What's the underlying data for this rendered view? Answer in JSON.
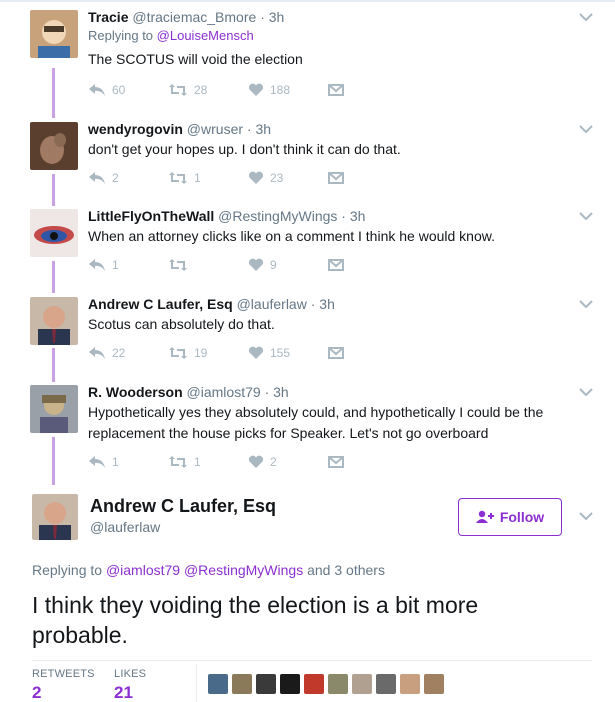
{
  "tweets": [
    {
      "name": "Tracie",
      "handle": "@traciemac_Bmore",
      "time": "· 3h",
      "replying_label": "Replying to",
      "replying_to": "@LouiseMensch",
      "text": "The SCOTUS will void the election",
      "replies": "60",
      "retweets": "28",
      "likes": "188",
      "avatar_colors": [
        "#c8a27a",
        "#f0d7b8"
      ]
    },
    {
      "name": "wendyrogovin",
      "handle": "@wruser",
      "time": "· 3h",
      "text": "don't get your hopes up. I don't think it can do that.",
      "replies": "2",
      "retweets": "1",
      "likes": "23",
      "avatar_colors": [
        "#5a3e2e",
        "#a07a62"
      ]
    },
    {
      "name": "LittleFlyOnTheWall",
      "handle": "@RestingMyWings",
      "time": "· 3h",
      "text": "When an attorney clicks like on a comment I think he would know.",
      "replies": "1",
      "retweets": "",
      "likes": "9",
      "avatar_colors": [
        "#c44a4a",
        "#2f56a6"
      ]
    },
    {
      "name": "Andrew C Laufer, Esq",
      "handle": "@lauferlaw",
      "time": "· 3h",
      "text": "Scotus can absolutely do that.",
      "replies": "22",
      "retweets": "19",
      "likes": "155",
      "avatar_colors": [
        "#d8a48a",
        "#2a3550"
      ]
    },
    {
      "name": "R. Wooderson",
      "handle": "@iamlost79",
      "time": "· 3h",
      "text_line1": "Hypothetically yes they absolutely could, and hypothetically I could be the",
      "text_line2": "replacement the house picks for Speaker. Let's not go overboard",
      "replies": "1",
      "retweets": "1",
      "likes": "2",
      "avatar_colors": [
        "#7a6a4a",
        "#c9b38a"
      ]
    }
  ],
  "main": {
    "name": "Andrew C Laufer, Esq",
    "handle": "@lauferlaw",
    "follow_label": "Follow",
    "replying_label": "Replying to",
    "replying_to_1": "@iamlost79",
    "replying_to_2": "@RestingMyWings",
    "replying_rest": "and 3 others",
    "text_line1": "I think they voiding the election is a bit more",
    "text_line2": "probable.",
    "retweets_label": "RETWEETS",
    "retweets_value": "2",
    "likes_label": "LIKES",
    "likes_value": "21",
    "avatar_colors": [
      "#d8a48a",
      "#2a3550"
    ]
  },
  "likers": [
    "#4a6a8a",
    "#8a7a5a",
    "#3a3a3a",
    "#1a1a1a",
    "#c0392b",
    "#8a8a6a",
    "#b0a090",
    "#6a6a6a",
    "#c8a080",
    "#a08060"
  ],
  "colors": {
    "accent": "#8c2fd1",
    "thread": "#c9a2e6",
    "muted": "#aab8c2"
  }
}
